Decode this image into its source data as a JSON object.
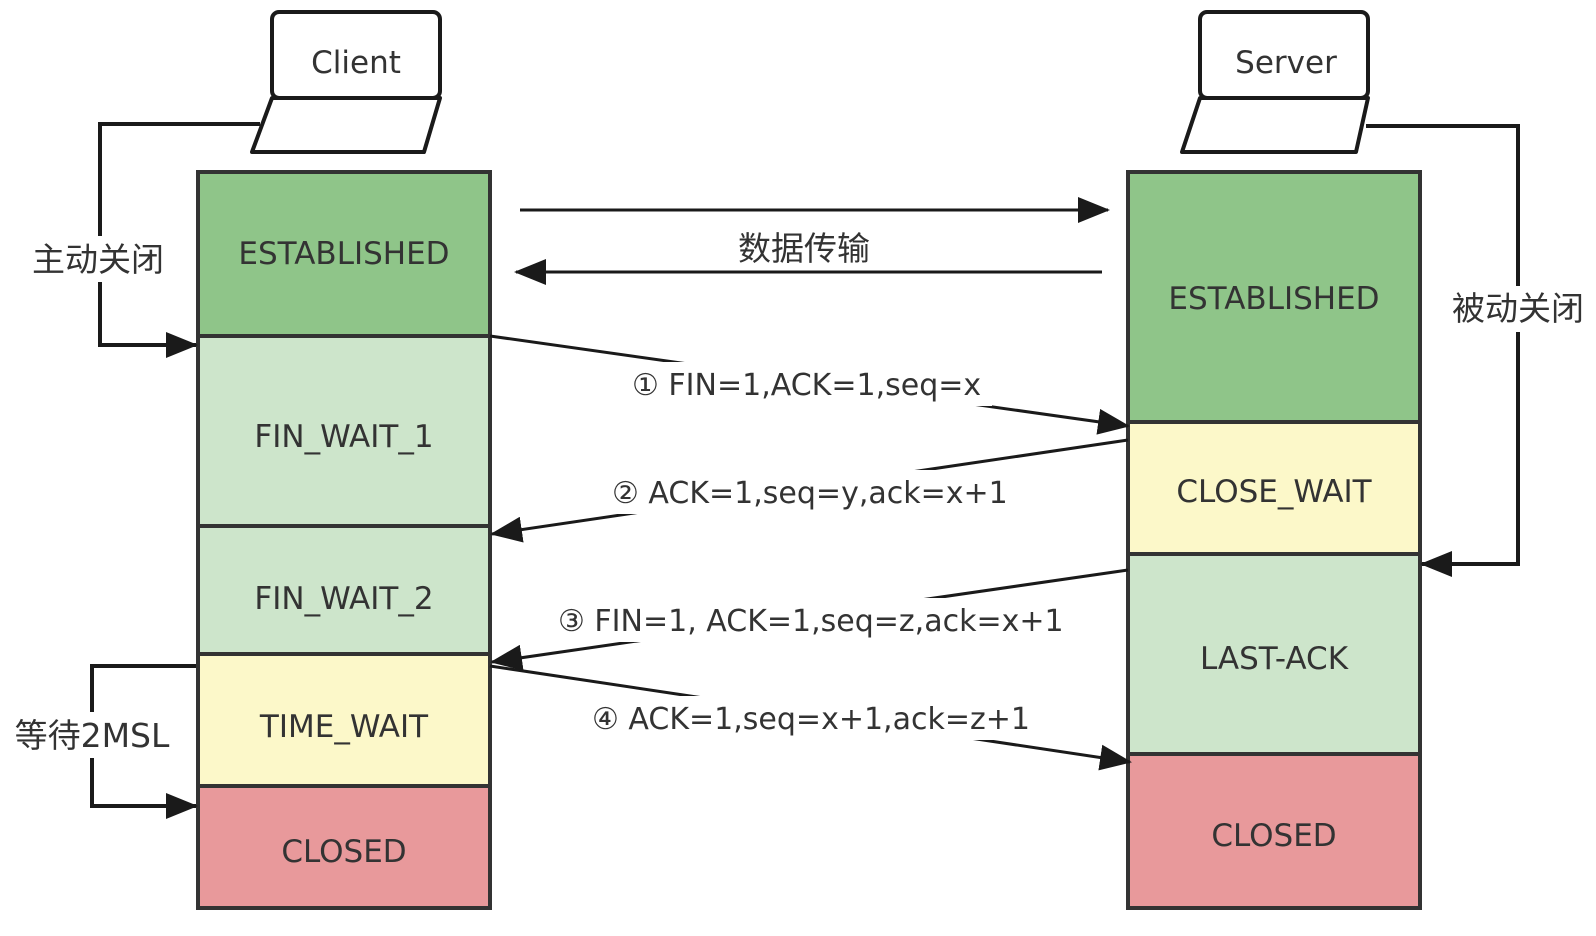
{
  "colors": {
    "established": "#8fc589",
    "wait_green": "#cde5cb",
    "wait_yellow": "#fcf8c9",
    "closed": "#e8999b",
    "border": "#333333",
    "text": "#333333"
  },
  "client": {
    "laptop_label": "Client",
    "laptop_icon": "laptop-icon",
    "states": [
      {
        "label": "ESTABLISHED",
        "kind": "established"
      },
      {
        "label": "FIN_WAIT_1",
        "kind": "wait_green"
      },
      {
        "label": "FIN_WAIT_2",
        "kind": "wait_green"
      },
      {
        "label": "TIME_WAIT",
        "kind": "wait_yellow"
      },
      {
        "label": "CLOSED",
        "kind": "closed"
      }
    ],
    "active_close_label": "主动关闭",
    "wait_2msl_label": "等待2MSL"
  },
  "server": {
    "laptop_label": "Server",
    "laptop_icon": "laptop-icon",
    "states": [
      {
        "label": "ESTABLISHED",
        "kind": "established"
      },
      {
        "label": "CLOSE_WAIT",
        "kind": "wait_yellow"
      },
      {
        "label": "LAST-ACK",
        "kind": "wait_green"
      },
      {
        "label": "CLOSED",
        "kind": "closed"
      }
    ],
    "passive_close_label": "被动关闭"
  },
  "data_transfer_label": "数据传输",
  "messages": [
    {
      "label": "① FIN=1,ACK=1,seq=x"
    },
    {
      "label": "② ACK=1,seq=y,ack=x+1"
    },
    {
      "label": "③ FIN=1,  ACK=1,seq=z,ack=x+1"
    },
    {
      "label": "④ ACK=1,seq=x+1,ack=z+1"
    }
  ]
}
